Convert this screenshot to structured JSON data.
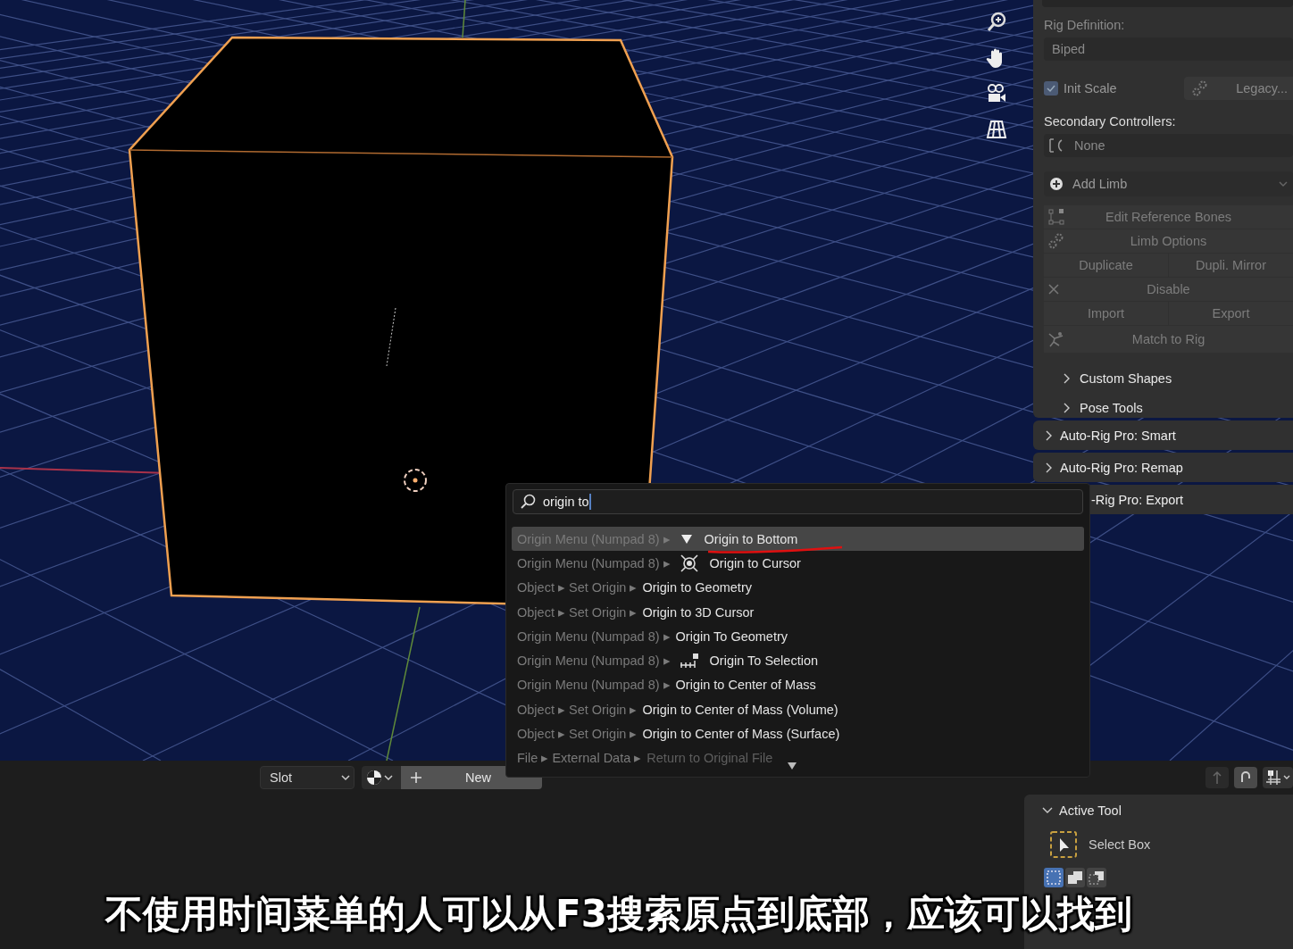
{
  "sidebar": {
    "rig_definition": {
      "label": "Rig Definition:",
      "value": "Biped"
    },
    "init_scale": {
      "label": "Init Scale",
      "checked": true
    },
    "legacy_button": "Legacy...",
    "secondary_controllers": {
      "label": "Secondary Controllers:",
      "value": "None"
    },
    "add_limb": "Add Limb",
    "tool_rows": [
      [
        {
          "label": "Edit Reference Bones",
          "kind": "bones"
        }
      ],
      [
        {
          "label": "Limb Options",
          "kind": "gear"
        }
      ],
      [
        {
          "label": "Duplicate",
          "kind": "plain"
        },
        {
          "label": "Dupli. Mirror",
          "kind": "plain"
        }
      ],
      [
        {
          "label": "Disable",
          "kind": "cross"
        }
      ],
      [
        {
          "label": "Import",
          "kind": "plain"
        },
        {
          "label": "Export",
          "kind": "plain"
        }
      ],
      [
        {
          "label": "Match to Rig",
          "kind": "figure"
        }
      ]
    ],
    "subpanels": [
      {
        "label": "Custom Shapes",
        "expanded": false
      },
      {
        "label": "Pose Tools",
        "expanded": false
      }
    ]
  },
  "panels": [
    {
      "label": "Auto-Rig Pro: Smart",
      "expanded": false
    },
    {
      "label": "Auto-Rig Pro: Remap",
      "expanded": false
    },
    {
      "label": "-Rig Pro: Export"
    }
  ],
  "search": {
    "query": "origin to",
    "results": [
      {
        "path": "Origin Menu (Numpad 8) ▸",
        "kind": "triangle",
        "label": "Origin to Bottom",
        "selected": true,
        "disabled": false
      },
      {
        "path": "Origin Menu (Numpad 8) ▸",
        "kind": "cursor",
        "label": "Origin to Cursor",
        "selected": false,
        "disabled": false
      },
      {
        "path": "Object ▸ Set Origin ▸",
        "kind": "none",
        "label": "Origin to Geometry",
        "selected": false,
        "disabled": false
      },
      {
        "path": "Object ▸ Set Origin ▸",
        "kind": "none",
        "label": "Origin to 3D Cursor",
        "selected": false,
        "disabled": false
      },
      {
        "path": "Origin Menu (Numpad 8) ▸",
        "kind": "none",
        "label": "Origin To Geometry",
        "selected": false,
        "disabled": false
      },
      {
        "path": "Origin Menu (Numpad 8) ▸",
        "kind": "selection",
        "label": "Origin To Selection",
        "selected": false,
        "disabled": false
      },
      {
        "path": "Origin Menu (Numpad 8) ▸",
        "kind": "none",
        "label": "Origin to Center of Mass",
        "selected": false,
        "disabled": false
      },
      {
        "path": "Object ▸ Set Origin ▸",
        "kind": "none",
        "label": "Origin to Center of Mass (Volume)",
        "selected": false,
        "disabled": false
      },
      {
        "path": "Object ▸ Set Origin ▸",
        "kind": "none",
        "label": "Origin to Center of Mass (Surface)",
        "selected": false,
        "disabled": false
      },
      {
        "path": "File ▸ External Data ▸",
        "kind": "none",
        "label": "Return to Original File",
        "selected": false,
        "disabled": true
      }
    ]
  },
  "material_bar": {
    "slot": "Slot",
    "new_button": "New"
  },
  "active_tool": {
    "title": "Active Tool",
    "expanded": true,
    "tool": "Select Box",
    "modes": [
      {
        "kind": "set",
        "selected": true
      },
      {
        "kind": "extend",
        "selected": false
      },
      {
        "kind": "subtract",
        "selected": false
      }
    ]
  },
  "subtitle": "不使用时间菜单的人可以从F3搜索原点到底部，应该可以找到"
}
